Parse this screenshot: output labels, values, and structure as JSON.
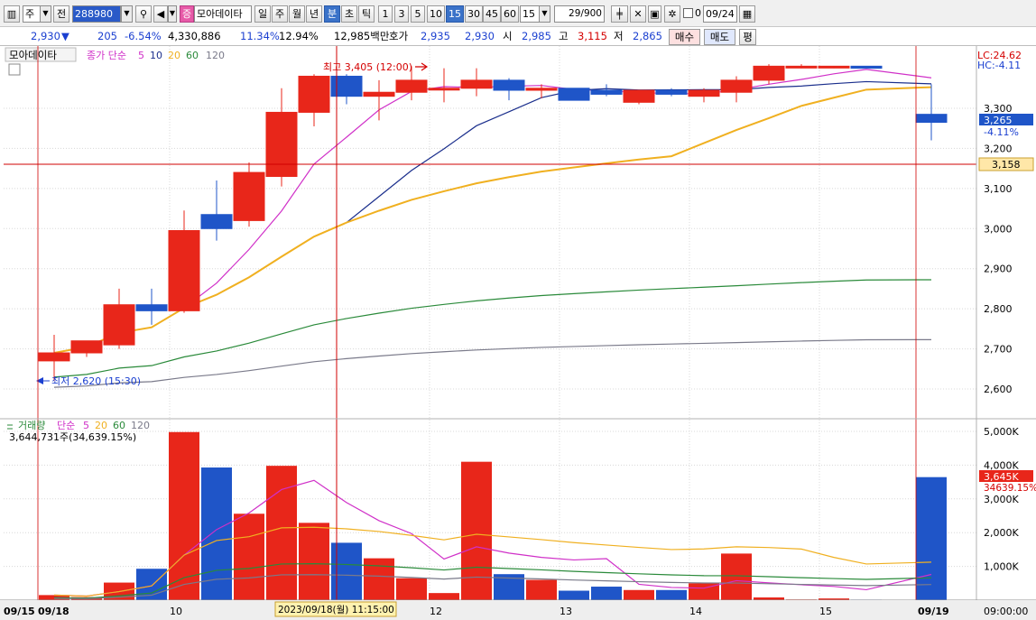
{
  "toolbar": {
    "type_value": "주",
    "mode_label": "전",
    "code_value": "288980",
    "search_icon": "magnifier-icon",
    "sound_icon": "speaker-icon",
    "market_badge": "증",
    "stock_name": "모아데이타",
    "period_buttons": [
      "일",
      "주",
      "월",
      "년",
      "분",
      "초",
      "틱"
    ],
    "period_active": "분",
    "minute_buttons": [
      "1",
      "3",
      "5",
      "10",
      "15",
      "30",
      "45",
      "60"
    ],
    "minute_active": "15",
    "minute_select": "15",
    "count_current": "29",
    "count_total": "/900",
    "date_value": "09/24",
    "checkbox_label": "0"
  },
  "quote": {
    "price": "2,930",
    "direction_symbol": "▼",
    "change": "205",
    "change_pct": "-6.54%",
    "volume": "4,330,886",
    "turnover_pct": "11.34%",
    "volume_ratio_pct": "12.94%",
    "amount": "12,985백만",
    "bid_label": "호가",
    "ask_price": "2,935",
    "bid_price": "2,930",
    "open_label": "시",
    "open": "2,985",
    "high_label": "고",
    "high": "3,115",
    "low_label": "저",
    "low": "2,865",
    "buy_label": "매수",
    "sell_label": "매도",
    "eval_label": "평"
  },
  "price_panel": {
    "stock_label": "모아데이타",
    "ma_title": "종가 단순",
    "ma_periods": [
      "5",
      "10",
      "20",
      "60",
      "120"
    ],
    "lc_text": "LC:24.62",
    "hc_text": "HC:-4.11",
    "high_marker": "최고 3,405 (12:00)",
    "low_marker": "최저 2,620 (15:30)",
    "current_price_label": "3,265",
    "current_change_label": "-4.11%",
    "crosshair_price_label": "3,158",
    "y_ticks": [
      "3,300",
      "3,200",
      "3,100",
      "3,000",
      "2,900",
      "2,800",
      "2,700",
      "2,600"
    ]
  },
  "volume_panel": {
    "title": "거래량",
    "ma_title": "단순",
    "ma_periods": [
      "5",
      "20",
      "60",
      "120"
    ],
    "summary": "3,644,731주(34,639.15%)",
    "current_label": "3,645K",
    "current_pct_label": "34639.15%",
    "y_ticks": [
      "5,000K",
      "4,000K",
      "3,000K",
      "2,000K",
      "1,000K"
    ]
  },
  "x_axis": {
    "labels": [
      "09/15",
      "09/18",
      "10",
      "12",
      "13",
      "14",
      "15",
      "09/19"
    ],
    "crosshair_time": "2023/09/18(월) 11:15:00",
    "right_time": "09:00:00"
  },
  "colors": {
    "up": "#e8261a",
    "down": "#1f55c8",
    "ma5": "#d030c8",
    "ma10": "#1a2e8c",
    "ma20": "#f0b020",
    "ma60": "#2a8a3a",
    "ma120": "#7a7a8a",
    "crosshair": "#d00000"
  },
  "chart_data": {
    "type": "candlestick",
    "price_ylim": [
      2560,
      3430
    ],
    "volume_ylim": [
      0,
      5200000
    ],
    "candles": [
      {
        "x": "09/18 09:15",
        "open": 2670,
        "high": 2735,
        "low": 2620,
        "close": 2690,
        "volume": 150000
      },
      {
        "x": "09/18 09:30",
        "open": 2690,
        "high": 2720,
        "low": 2680,
        "close": 2720,
        "volume": 90000
      },
      {
        "x": "09/18 09:45",
        "open": 2710,
        "high": 2850,
        "low": 2700,
        "close": 2810,
        "volume": 520000
      },
      {
        "x": "09/18 10:00",
        "open": 2810,
        "high": 2850,
        "low": 2760,
        "close": 2795,
        "volume": 930000
      },
      {
        "x": "09/18 10:15",
        "open": 2795,
        "high": 3045,
        "low": 2790,
        "close": 2995,
        "volume": 4980000
      },
      {
        "x": "09/18 10:30",
        "open": 3035,
        "high": 3120,
        "low": 2970,
        "close": 3000,
        "volume": 3930000
      },
      {
        "x": "09/18 10:45",
        "open": 3020,
        "high": 3165,
        "low": 3005,
        "close": 3140,
        "volume": 2560000
      },
      {
        "x": "09/18 11:00",
        "open": 3130,
        "high": 3350,
        "low": 3105,
        "close": 3290,
        "volume": 3980000
      },
      {
        "x": "09/18 11:15",
        "open": 3290,
        "high": 3385,
        "low": 3255,
        "close": 3380,
        "volume": 2290000
      },
      {
        "x": "09/18 11:30",
        "open": 3380,
        "high": 3385,
        "low": 3310,
        "close": 3330,
        "volume": 1700000
      },
      {
        "x": "09/18 11:45",
        "open": 3330,
        "high": 3370,
        "low": 3270,
        "close": 3340,
        "volume": 1240000
      },
      {
        "x": "09/18 12:00",
        "open": 3340,
        "high": 3405,
        "low": 3320,
        "close": 3370,
        "volume": 650000
      },
      {
        "x": "09/18 12:15",
        "open": 3350,
        "high": 3400,
        "low": 3315,
        "close": 3350,
        "volume": 210000
      },
      {
        "x": "09/18 12:30",
        "open": 3350,
        "high": 3400,
        "low": 3330,
        "close": 3370,
        "volume": 4100000
      },
      {
        "x": "09/18 12:45",
        "open": 3370,
        "high": 3375,
        "low": 3320,
        "close": 3345,
        "volume": 770000
      },
      {
        "x": "09/18 13:00",
        "open": 3345,
        "high": 3360,
        "low": 3325,
        "close": 3350,
        "volume": 600000
      },
      {
        "x": "09/18 13:15",
        "open": 3350,
        "high": 3350,
        "low": 3320,
        "close": 3320,
        "volume": 280000
      },
      {
        "x": "09/18 13:30",
        "open": 3345,
        "high": 3360,
        "low": 3330,
        "close": 3335,
        "volume": 400000
      },
      {
        "x": "09/18 13:45",
        "open": 3315,
        "high": 3345,
        "low": 3310,
        "close": 3345,
        "volume": 300000
      },
      {
        "x": "09/18 14:00",
        "open": 3345,
        "high": 3350,
        "low": 3330,
        "close": 3335,
        "volume": 300000
      },
      {
        "x": "09/18 14:15",
        "open": 3330,
        "high": 3350,
        "low": 3315,
        "close": 3345,
        "volume": 500000
      },
      {
        "x": "09/18 14:30",
        "open": 3340,
        "high": 3380,
        "low": 3315,
        "close": 3370,
        "volume": 1380000
      },
      {
        "x": "09/18 14:45",
        "open": 3370,
        "high": 3410,
        "low": 3360,
        "close": 3405,
        "volume": 80000
      },
      {
        "x": "09/18 15:00",
        "open": 3405,
        "high": 3410,
        "low": 3400,
        "close": 3405,
        "volume": 20000
      },
      {
        "x": "09/18 15:15",
        "open": 3405,
        "high": 3405,
        "low": 3400,
        "close": 3405,
        "volume": 50000
      },
      {
        "x": "09/18 15:30",
        "open": 3405,
        "high": 3405,
        "low": 3400,
        "close": 3400,
        "volume": 15000
      },
      {
        "x": "09/19 09:00",
        "open": 3285,
        "high": 3360,
        "low": 3220,
        "close": 3265,
        "volume": 3644731
      }
    ]
  }
}
